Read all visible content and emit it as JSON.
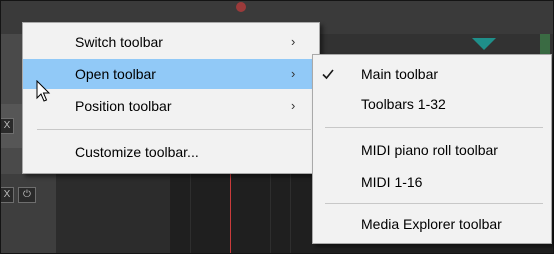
{
  "main_menu": {
    "items": [
      {
        "label": "Switch toolbar",
        "has_submenu": true
      },
      {
        "label": "Open toolbar",
        "has_submenu": true,
        "highlighted": true
      },
      {
        "label": "Position toolbar",
        "has_submenu": true
      },
      {
        "label": "Customize toolbar...",
        "has_submenu": false
      }
    ],
    "submenu_arrow": "›"
  },
  "submenu": {
    "items": [
      {
        "label": "Main toolbar",
        "checked": true
      },
      {
        "label": "Toolbars 1-32",
        "checked": false
      },
      {
        "label": "MIDI piano roll toolbar",
        "checked": false
      },
      {
        "label": "MIDI 1-16",
        "checked": false
      },
      {
        "label": "Media Explorer toolbar",
        "checked": false
      }
    ]
  },
  "background": {
    "x_button_1": "X",
    "x_button_2": "X",
    "power_button": "⏻"
  },
  "icons": {
    "checkmark": "check-icon",
    "pointer": "mouse-pointer-icon"
  },
  "colors": {
    "highlight": "#91c9f7",
    "menu_bg": "#f2f2f2",
    "playcursor": "#c93b3b",
    "marker": "#1f8f8a"
  }
}
